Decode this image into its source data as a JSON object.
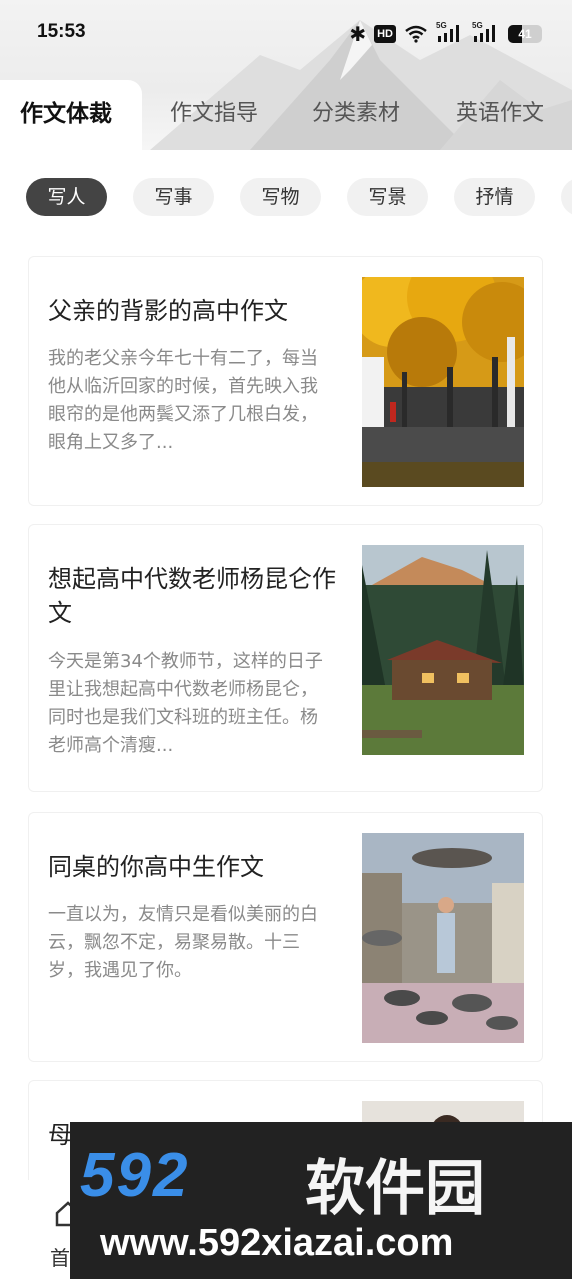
{
  "status_bar": {
    "time": "15:53",
    "bluetooth_icon": "bluetooth-icon",
    "hd_badge": "HD",
    "wifi_icon": "wifi-icon",
    "signal_label_1": "5G",
    "signal_label_2": "5G",
    "battery_level": "41",
    "battery_fraction": 0.41
  },
  "tabs": [
    {
      "label": "作文体裁",
      "active": true
    },
    {
      "label": "作文指导",
      "active": false
    },
    {
      "label": "分类素材",
      "active": false
    },
    {
      "label": "英语作文",
      "active": false
    }
  ],
  "chips": [
    {
      "label": "写人",
      "active": true
    },
    {
      "label": "写事",
      "active": false
    },
    {
      "label": "写物",
      "active": false
    },
    {
      "label": "写景",
      "active": false
    },
    {
      "label": "抒情",
      "active": false
    }
  ],
  "articles": [
    {
      "title": "父亲的背影的高中作文",
      "excerpt": "我的老父亲今年七十有二了，每当他从临沂回家的时候，首先映入我眼帘的是他两鬓又添了几根白发，眼角上又多了...",
      "image": "autumn-trees-photo"
    },
    {
      "title": "想起高中代数老师杨昆仑作文",
      "excerpt": "今天是第34个教师节，这样的日子里让我想起高中代数老师杨昆仑，同时也是我们文科班的班主任。杨老师高个清瘦...",
      "image": "mountain-cabin-photo"
    },
    {
      "title": "同桌的你高中生作文",
      "excerpt": "一直以为，友情只是看似美丽的白云，飘忽不定，易聚易散。十三岁，我遇见了你。",
      "image": "pigeons-square-photo"
    },
    {
      "title": "母",
      "excerpt": "",
      "image": "portrait-photo"
    }
  ],
  "bottom_nav": {
    "home_label": "首",
    "home_icon": "home-icon"
  },
  "watermark": {
    "logo": "592",
    "name": "软件园",
    "url": "www.592xiazai.com"
  },
  "colors": {
    "active_chip": "#444444",
    "chip_bg": "#f1f1f1",
    "watermark_bg": "#222222",
    "watermark_logo": "#3a8ee8"
  }
}
